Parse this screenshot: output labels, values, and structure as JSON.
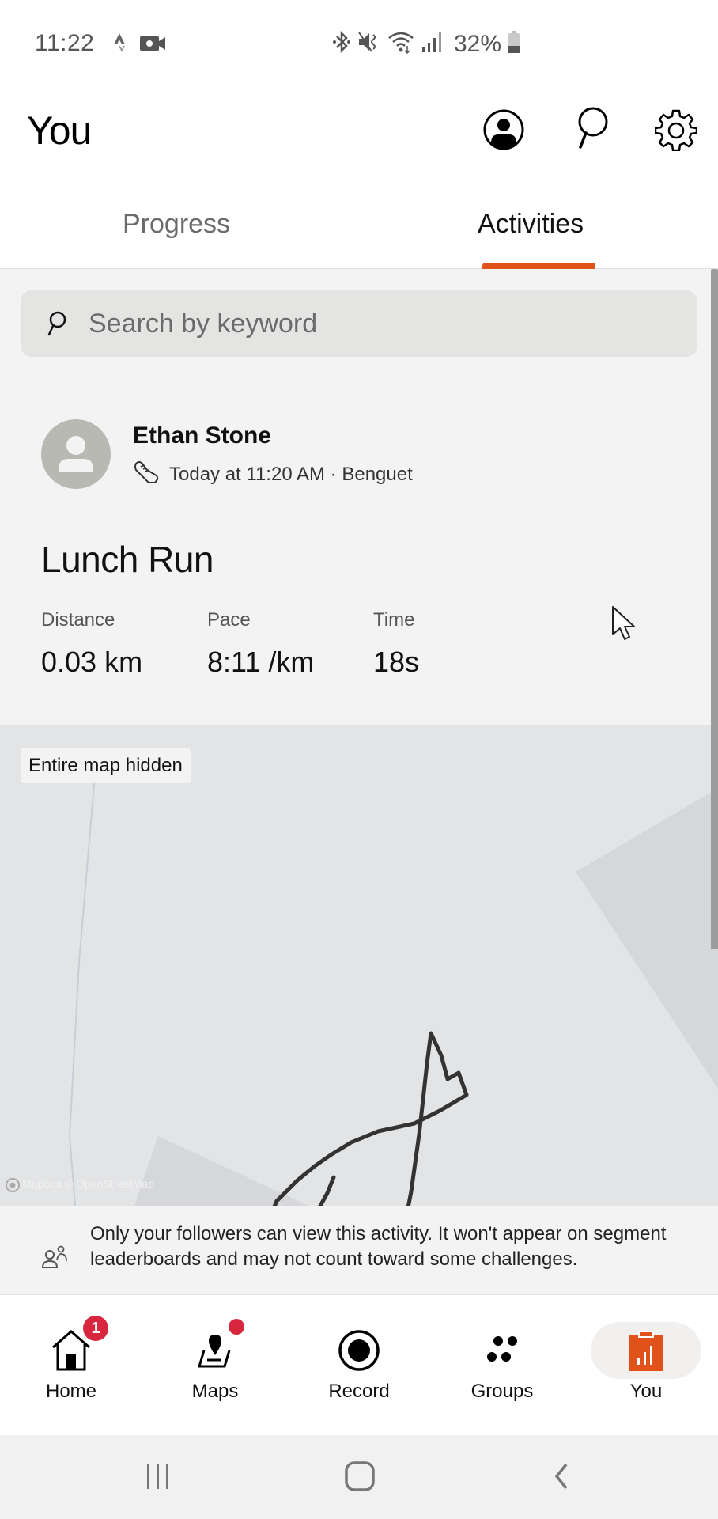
{
  "status_bar": {
    "time": "11:22",
    "left_icons": [
      "strava-notification-icon",
      "video-recording-icon"
    ],
    "right_icons": [
      "bluetooth-icon",
      "mute-vibrate-icon",
      "wifi-icon",
      "signal-icon"
    ],
    "battery": "32%"
  },
  "header": {
    "title": "You",
    "icons": [
      "profile-icon",
      "search-icon",
      "settings-icon"
    ]
  },
  "tabs": [
    {
      "label": "Progress",
      "active": false
    },
    {
      "label": "Activities",
      "active": true
    }
  ],
  "search": {
    "placeholder": "Search by keyword",
    "value": ""
  },
  "activity": {
    "athlete_name": "Ethan Stone",
    "sport_icon": "running-shoe-icon",
    "meta": "Today at 11:20 AM · Benguet",
    "title": "Lunch Run",
    "stats": [
      {
        "label": "Distance",
        "value": "0.03 km"
      },
      {
        "label": "Pace",
        "value": "8:11 /km"
      },
      {
        "label": "Time",
        "value": "18s"
      }
    ],
    "map": {
      "label": "Entire map hidden",
      "attribution": "© Mapbox © OpenStreetMap"
    },
    "privacy_note": "Only your followers can view this activity. It won't appear on segment leaderboards and may not count toward some challenges."
  },
  "bottom_nav": [
    {
      "label": "Home",
      "icon": "home-icon",
      "badge": "1",
      "active": false
    },
    {
      "label": "Maps",
      "icon": "maps-icon",
      "dot": true,
      "active": false
    },
    {
      "label": "Record",
      "icon": "record-icon",
      "active": false
    },
    {
      "label": "Groups",
      "icon": "groups-icon",
      "active": false
    },
    {
      "label": "You",
      "icon": "you-icon",
      "active": true
    }
  ],
  "colors": {
    "accent": "#e0521a",
    "badge": "#d7263d",
    "content_bg": "#f3f3f3",
    "map_bg": "#e3e4e6"
  }
}
